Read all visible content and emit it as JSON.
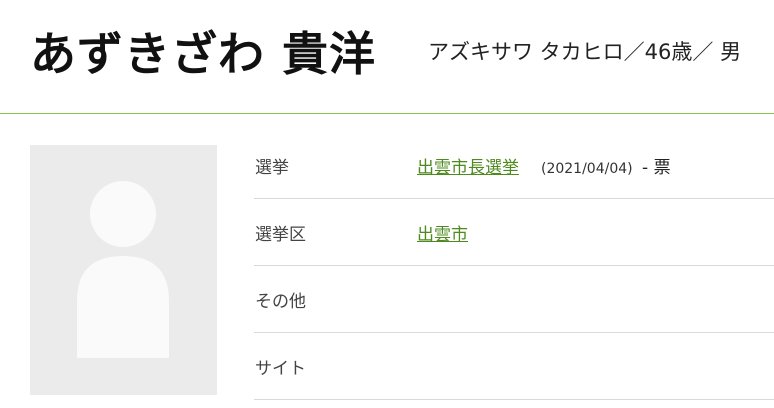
{
  "candidate": {
    "name": "あずきざわ 貴洋",
    "kana_age_gender": "アズキサワ タカヒロ／46歳／ 男"
  },
  "info": {
    "rows": [
      {
        "label": "選挙",
        "link_text": "出雲市長選挙",
        "date": "(2021/04/04)",
        "votes": "- 票"
      },
      {
        "label": "選挙区",
        "link_text": "出雲市"
      },
      {
        "label": "その他"
      },
      {
        "label": "サイト"
      }
    ]
  },
  "colors": {
    "accent": "#8bc34a",
    "link": "#4e8a1e",
    "photo_bg": "#ebebeb"
  }
}
